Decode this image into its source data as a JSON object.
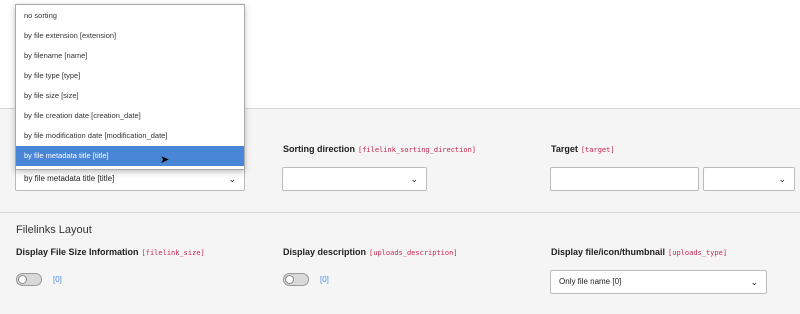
{
  "dropdown": {
    "options": [
      "no sorting",
      "by file extension [extension]",
      "by filename [name]",
      "by file type [type]",
      "by file size [size]",
      "by file creation date [creation_date]",
      "by file modification date [modification_date]",
      "by file metadata title [title]"
    ],
    "highlighted_index": 7
  },
  "sorting": {
    "selected": "by file metadata title [title]"
  },
  "sorting_direction": {
    "label": "Sorting direction",
    "code": "[filelink_sorting_direction]",
    "value": ""
  },
  "target": {
    "label": "Target",
    "code": "[target]",
    "input_value": "",
    "select_value": ""
  },
  "filelinks_layout": {
    "title": "Filelinks Layout",
    "file_size": {
      "label": "Display File Size Information",
      "code": "[filelink_size]",
      "value": "[0]"
    },
    "description": {
      "label": "Display description",
      "code": "[uploads_description]",
      "value": "[0]"
    },
    "uploads_type": {
      "label": "Display file/icon/thumbnail",
      "code": "[uploads_type]",
      "selected": "Only file name [0]"
    }
  },
  "colors": {
    "highlight": "#4a86d8",
    "code": "#c7254e",
    "toggle_value": "#4a90e2"
  }
}
